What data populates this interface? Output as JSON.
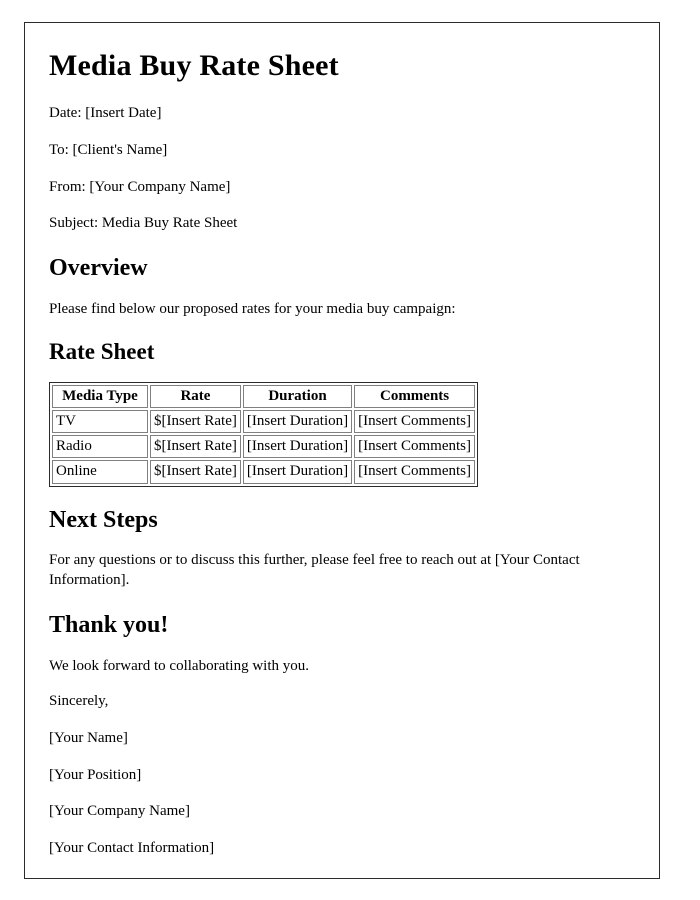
{
  "document": {
    "title": "Media Buy Rate Sheet",
    "meta": [
      "Date: [Insert Date]",
      "To: [Client's Name]",
      "From: [Your Company Name]",
      "Subject: Media Buy Rate Sheet"
    ],
    "overview": {
      "heading": "Overview",
      "paragraph": "Please find below our proposed rates for your media buy campaign:"
    },
    "rate_sheet": {
      "heading": "Rate Sheet",
      "columns": [
        "Media Type",
        "Rate",
        "Duration",
        "Comments"
      ],
      "rows": [
        {
          "media_type": "TV",
          "rate": "$[Insert Rate]",
          "duration": "[Insert Duration]",
          "comments": "[Insert Comments]"
        },
        {
          "media_type": "Radio",
          "rate": "$[Insert Rate]",
          "duration": "[Insert Duration]",
          "comments": "[Insert Comments]"
        },
        {
          "media_type": "Online",
          "rate": "$[Insert Rate]",
          "duration": "[Insert Duration]",
          "comments": "[Insert Comments]"
        }
      ]
    },
    "next_steps": {
      "heading": "Next Steps",
      "paragraph": "For any questions or to discuss this further, please feel free to reach out at [Your Contact Information]."
    },
    "thank_you": {
      "heading": "Thank you!",
      "paragraph": "We look forward to collaborating with you.",
      "closing": "Sincerely,",
      "signature": [
        "[Your Name]",
        "[Your Position]",
        "[Your Company Name]",
        "[Your Contact Information]"
      ]
    }
  }
}
